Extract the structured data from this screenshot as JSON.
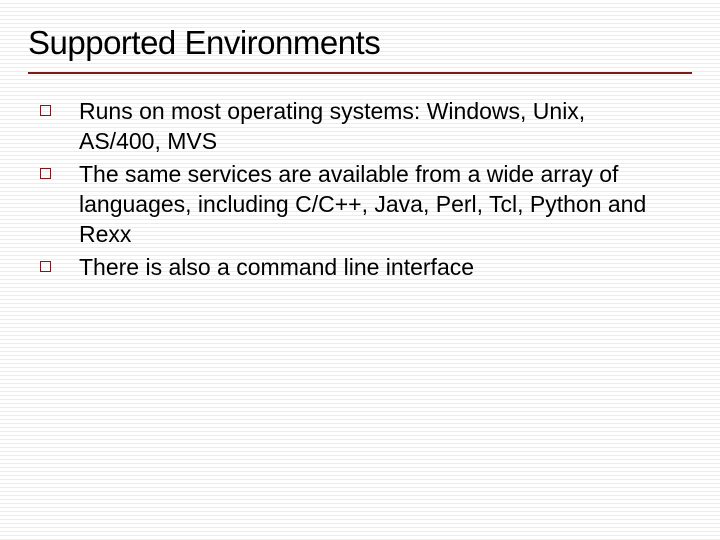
{
  "slide": {
    "title": "Supported Environments",
    "bullets": [
      {
        "text": "Runs on most operating systems: Windows, Unix, AS/400, MVS"
      },
      {
        "text": "The same services are available from a wide array of languages, including C/C++, Java, Perl, Tcl, Python and Rexx"
      },
      {
        "text": "There is also a command line interface"
      }
    ]
  }
}
